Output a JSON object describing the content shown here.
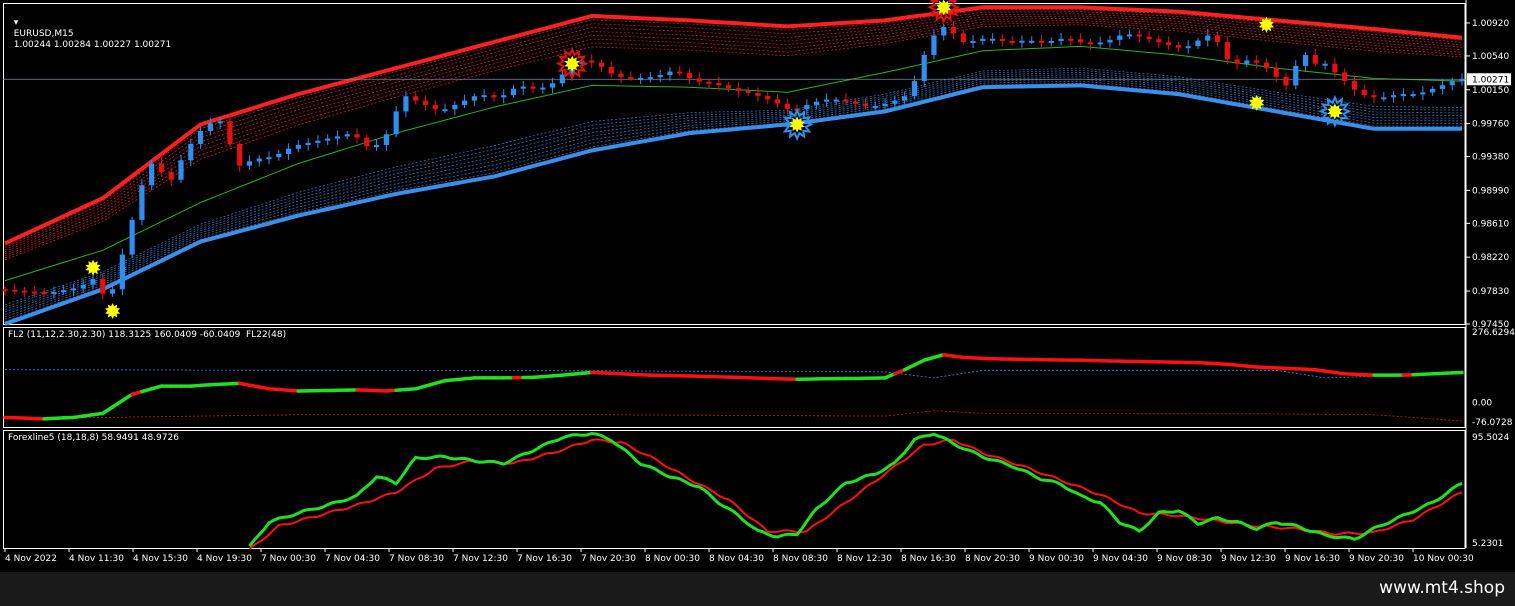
{
  "window": {
    "symbol_title": "EURUSD,M15",
    "ohlc": "1.00244 1.00284 1.00227 1.00271"
  },
  "watermark": "www.mt4.shop",
  "colors": {
    "background": "#000000",
    "bull": "#2e8ff0",
    "bear": "#e61010",
    "band_upper": "#ff2020",
    "band_lower": "#3a8fe8",
    "midline": "#21b521",
    "fl_up": "#20e020",
    "fl_down": "#ff1010",
    "marker": "#ffff00",
    "axis_text": "#ffffff",
    "frame": "#ffffff"
  },
  "icons": {
    "trigger": "star-burst-icon",
    "dropdown": "chevron-down-icon"
  },
  "chart_data": [
    {
      "type": "candlestick",
      "title": "EURUSD,M15  1.00244 1.00284 1.00227 1.00271",
      "yticks": [
        "1.00920",
        "1.00540",
        "1.00150",
        "0.99760",
        "0.99380",
        "0.98990",
        "0.98610",
        "0.98220",
        "0.97830",
        "0.97450"
      ],
      "ylim": [
        0.9745,
        1.0115
      ],
      "current_price": "1.00271",
      "xticks": [
        "4 Nov 2022",
        "4 Nov 11:30",
        "4 Nov 15:30",
        "4 Nov 19:30",
        "7 Nov 00:30",
        "7 Nov 04:30",
        "7 Nov 08:30",
        "7 Nov 12:30",
        "7 Nov 16:30",
        "7 Nov 20:30",
        "8 Nov 00:30",
        "8 Nov 04:30",
        "8 Nov 08:30",
        "8 Nov 12:30",
        "8 Nov 16:30",
        "8 Nov 20:30",
        "9 Nov 00:30",
        "9 Nov 04:30",
        "9 Nov 08:30",
        "9 Nov 12:30",
        "9 Nov 16:30",
        "9 Nov 20:30",
        "10 Nov 00:30"
      ],
      "price_path": [
        [
          0,
          0.9785
        ],
        [
          3,
          0.9782
        ],
        [
          5,
          0.9781
        ],
        [
          8,
          0.9787
        ],
        [
          10,
          0.98
        ],
        [
          11,
          0.976
        ],
        [
          12,
          0.981
        ],
        [
          13,
          0.984
        ],
        [
          14,
          0.989
        ],
        [
          15,
          0.992
        ],
        [
          16,
          0.994
        ],
        [
          17,
          0.99
        ],
        [
          19,
          0.9945
        ],
        [
          21,
          0.9975
        ],
        [
          23,
          0.998
        ],
        [
          24,
          0.9925
        ],
        [
          26,
          0.9935
        ],
        [
          28,
          0.9938
        ],
        [
          30,
          0.995
        ],
        [
          32,
          0.9955
        ],
        [
          34,
          0.996
        ],
        [
          36,
          0.9965
        ],
        [
          38,
          0.9945
        ],
        [
          40,
          0.997
        ],
        [
          41,
          1.001
        ],
        [
          43,
          1.0
        ],
        [
          45,
          0.999
        ],
        [
          47,
          1.0
        ],
        [
          49,
          1.001
        ],
        [
          51,
          1.0005
        ],
        [
          53,
          1.002
        ],
        [
          55,
          1.0015
        ],
        [
          57,
          1.0025
        ],
        [
          58,
          1.004
        ],
        [
          59,
          1.005
        ],
        [
          61,
          1.0045
        ],
        [
          63,
          1.003
        ],
        [
          65,
          1.0028
        ],
        [
          67,
          1.003
        ],
        [
          69,
          1.0038
        ],
        [
          71,
          1.0025
        ],
        [
          73,
          1.0022
        ],
        [
          75,
          1.0015
        ],
        [
          77,
          1.001
        ],
        [
          79,
          1.0002
        ],
        [
          81,
          0.999
        ],
        [
          83,
          1.0
        ],
        [
          85,
          1.0005
        ],
        [
          87,
          1.0
        ],
        [
          89,
          0.9995
        ],
        [
          91,
          1.0
        ],
        [
          93,
          1.001
        ],
        [
          94,
          1.004
        ],
        [
          95,
          1.007
        ],
        [
          96,
          1.0085
        ],
        [
          97,
          1.009
        ],
        [
          98,
          1.007
        ],
        [
          99,
          1.007
        ],
        [
          101,
          1.0075
        ],
        [
          103,
          1.007
        ],
        [
          105,
          1.0072
        ],
        [
          107,
          1.007
        ],
        [
          109,
          1.0075
        ],
        [
          111,
          1.0068
        ],
        [
          113,
          1.007
        ],
        [
          115,
          1.008
        ],
        [
          117,
          1.0075
        ],
        [
          119,
          1.0068
        ],
        [
          121,
          1.0062
        ],
        [
          123,
          1.0075
        ],
        [
          124,
          1.008
        ],
        [
          125,
          1.006
        ],
        [
          126,
          1.004
        ],
        [
          127,
          1.005
        ],
        [
          129,
          1.0045
        ],
        [
          131,
          1.0025
        ],
        [
          132,
          1.0015
        ],
        [
          133,
          1.007
        ],
        [
          134,
          1.004
        ],
        [
          135,
          1.005
        ],
        [
          137,
          1.003
        ],
        [
          139,
          1.001
        ],
        [
          141,
          1.0005
        ],
        [
          143,
          1.001
        ],
        [
          145,
          1.001
        ],
        [
          147,
          1.0018
        ],
        [
          149,
          1.0027
        ]
      ],
      "bands": {
        "upper_outer": [
          [
            0,
            0.9838
          ],
          [
            10,
            0.989
          ],
          [
            20,
            0.9975
          ],
          [
            30,
            1.001
          ],
          [
            40,
            1.004
          ],
          [
            50,
            1.007
          ],
          [
            60,
            1.01
          ],
          [
            70,
            1.0095
          ],
          [
            80,
            1.0088
          ],
          [
            90,
            1.0095
          ],
          [
            100,
            1.011
          ],
          [
            110,
            1.011
          ],
          [
            120,
            1.0105
          ],
          [
            130,
            1.0095
          ],
          [
            140,
            1.0085
          ],
          [
            149,
            1.0075
          ]
        ],
        "lower_outer": [
          [
            0,
            0.9745
          ],
          [
            10,
            0.9785
          ],
          [
            20,
            0.984
          ],
          [
            30,
            0.987
          ],
          [
            40,
            0.9895
          ],
          [
            50,
            0.9915
          ],
          [
            60,
            0.9945
          ],
          [
            70,
            0.9965
          ],
          [
            80,
            0.9975
          ],
          [
            90,
            0.999
          ],
          [
            100,
            1.0018
          ],
          [
            110,
            1.002
          ],
          [
            120,
            1.001
          ],
          [
            130,
            0.999
          ],
          [
            140,
            0.997
          ],
          [
            149,
            0.997
          ]
        ],
        "midline": [
          [
            0,
            0.9795
          ],
          [
            10,
            0.983
          ],
          [
            20,
            0.9885
          ],
          [
            30,
            0.993
          ],
          [
            40,
            0.9965
          ],
          [
            50,
            0.9995
          ],
          [
            60,
            1.002
          ],
          [
            70,
            1.0018
          ],
          [
            80,
            1.0012
          ],
          [
            90,
            1.0035
          ],
          [
            100,
            1.006
          ],
          [
            110,
            1.0065
          ],
          [
            120,
            1.0055
          ],
          [
            130,
            1.004
          ],
          [
            140,
            1.0028
          ],
          [
            149,
            1.0025
          ]
        ]
      },
      "signals": [
        {
          "x": 9,
          "y": 0.981,
          "ring": false
        },
        {
          "x": 11,
          "y": 0.976,
          "ring": false
        },
        {
          "x": 58,
          "y": 1.0045,
          "ring": true
        },
        {
          "x": 81,
          "y": 0.9975,
          "ring": true
        },
        {
          "x": 96,
          "y": 1.011,
          "ring": true
        },
        {
          "x": 129,
          "y": 1.009,
          "ring": false
        },
        {
          "x": 128,
          "y": 1.0,
          "ring": false
        },
        {
          "x": 136,
          "y": 0.999,
          "ring": true
        }
      ]
    },
    {
      "type": "line",
      "title": "FL2 (11,12,2.30,2.30) 118.3125 160.0409 -60.0409  FL22(48)",
      "ylim": [
        -90,
        276.6294
      ],
      "yticks": [
        "276.6294",
        "0.00",
        "-76.0728"
      ],
      "series_main": [
        [
          0,
          -55
        ],
        [
          4,
          -60
        ],
        [
          7,
          -55
        ],
        [
          10,
          -40
        ],
        [
          13,
          30
        ],
        [
          16,
          60
        ],
        [
          19,
          60
        ],
        [
          21,
          65
        ],
        [
          24,
          70
        ],
        [
          27,
          50
        ],
        [
          30,
          42
        ],
        [
          33,
          44
        ],
        [
          36,
          46
        ],
        [
          39,
          42
        ],
        [
          42,
          50
        ],
        [
          45,
          80
        ],
        [
          48,
          90
        ],
        [
          51,
          90
        ],
        [
          54,
          92
        ],
        [
          57,
          100
        ],
        [
          60,
          110
        ],
        [
          63,
          105
        ],
        [
          66,
          100
        ],
        [
          69,
          98
        ],
        [
          72,
          95
        ],
        [
          75,
          92
        ],
        [
          78,
          88
        ],
        [
          81,
          85
        ],
        [
          84,
          87
        ],
        [
          87,
          88
        ],
        [
          90,
          90
        ],
        [
          92,
          120
        ],
        [
          94,
          155
        ],
        [
          96,
          175
        ],
        [
          98,
          165
        ],
        [
          101,
          160
        ],
        [
          104,
          158
        ],
        [
          107,
          156
        ],
        [
          110,
          155
        ],
        [
          113,
          152
        ],
        [
          116,
          150
        ],
        [
          119,
          148
        ],
        [
          122,
          146
        ],
        [
          125,
          140
        ],
        [
          128,
          130
        ],
        [
          131,
          125
        ],
        [
          134,
          120
        ],
        [
          137,
          105
        ],
        [
          140,
          100
        ],
        [
          143,
          100
        ],
        [
          146,
          105
        ],
        [
          149,
          110
        ]
      ],
      "series_upper": [
        [
          0,
          120
        ],
        [
          30,
          118
        ],
        [
          60,
          116
        ],
        [
          90,
          112
        ],
        [
          95,
          90
        ],
        [
          100,
          118
        ],
        [
          130,
          118
        ],
        [
          135,
          90
        ],
        [
          149,
          105
        ]
      ],
      "series_lower": [
        [
          0,
          -60
        ],
        [
          30,
          -45
        ],
        [
          60,
          -45
        ],
        [
          90,
          -50
        ],
        [
          95,
          -30
        ],
        [
          100,
          -40
        ],
        [
          130,
          -42
        ],
        [
          140,
          -45
        ],
        [
          149,
          -68
        ]
      ]
    },
    {
      "type": "line",
      "title": "Forexline5 (18,18,8) 58.9491 48.9726",
      "ylim": [
        5.2301,
        95.5024
      ],
      "yticks": [
        "95.5024",
        "5.2301"
      ],
      "fast": [
        [
          25,
          6
        ],
        [
          27,
          25
        ],
        [
          30,
          32
        ],
        [
          33,
          38
        ],
        [
          36,
          45
        ],
        [
          38,
          60
        ],
        [
          40,
          55
        ],
        [
          42,
          74
        ],
        [
          45,
          75
        ],
        [
          48,
          72
        ],
        [
          51,
          70
        ],
        [
          54,
          80
        ],
        [
          57,
          90
        ],
        [
          60,
          93
        ],
        [
          62,
          88
        ],
        [
          65,
          70
        ],
        [
          68,
          60
        ],
        [
          71,
          52
        ],
        [
          73,
          40
        ],
        [
          75,
          30
        ],
        [
          77,
          18
        ],
        [
          79,
          14
        ],
        [
          81,
          16
        ],
        [
          83,
          35
        ],
        [
          86,
          55
        ],
        [
          89,
          62
        ],
        [
          91,
          70
        ],
        [
          93,
          88
        ],
        [
          95,
          93
        ],
        [
          97,
          85
        ],
        [
          100,
          75
        ],
        [
          103,
          68
        ],
        [
          106,
          58
        ],
        [
          108,
          54
        ],
        [
          110,
          45
        ],
        [
          112,
          40
        ],
        [
          114,
          25
        ],
        [
          116,
          18
        ],
        [
          118,
          32
        ],
        [
          120,
          34
        ],
        [
          122,
          24
        ],
        [
          124,
          28
        ],
        [
          126,
          25
        ],
        [
          128,
          20
        ],
        [
          130,
          25
        ],
        [
          132,
          22
        ],
        [
          135,
          15
        ],
        [
          138,
          12
        ],
        [
          140,
          20
        ],
        [
          143,
          30
        ],
        [
          146,
          40
        ],
        [
          149,
          55
        ]
      ],
      "slow": [
        [
          25,
          4
        ],
        [
          28,
          22
        ],
        [
          32,
          30
        ],
        [
          36,
          38
        ],
        [
          40,
          48
        ],
        [
          44,
          66
        ],
        [
          48,
          72
        ],
        [
          52,
          70
        ],
        [
          56,
          78
        ],
        [
          60,
          88
        ],
        [
          63,
          86
        ],
        [
          66,
          75
        ],
        [
          70,
          58
        ],
        [
          74,
          42
        ],
        [
          78,
          18
        ],
        [
          82,
          18
        ],
        [
          86,
          40
        ],
        [
          90,
          62
        ],
        [
          94,
          84
        ],
        [
          97,
          88
        ],
        [
          100,
          78
        ],
        [
          104,
          68
        ],
        [
          108,
          57
        ],
        [
          112,
          46
        ],
        [
          116,
          32
        ],
        [
          120,
          30
        ],
        [
          124,
          26
        ],
        [
          128,
          22
        ],
        [
          132,
          20
        ],
        [
          136,
          16
        ],
        [
          140,
          17
        ],
        [
          144,
          27
        ],
        [
          149,
          48
        ]
      ]
    }
  ]
}
